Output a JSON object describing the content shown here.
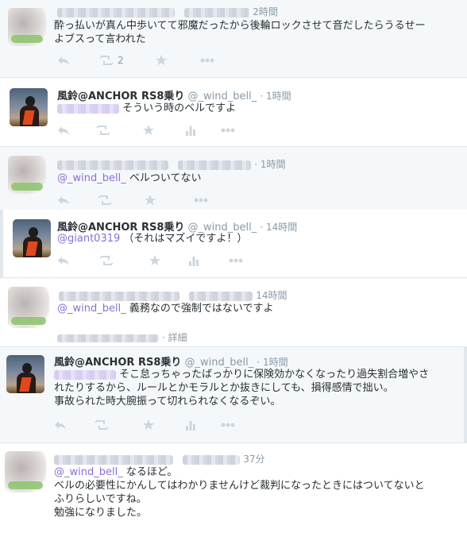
{
  "tweets": [
    {
      "time": "2時間",
      "text_lines": [
        "酔っ払いが真ん中歩いてて邪魔だったから後輪ロックさせて音だしたらうるせー",
        "よブスって言われた"
      ],
      "retweet_count": "2"
    },
    {
      "name": "風鈴@ANCHOR RS8乗り",
      "handle": "@_wind_bell_",
      "time": "· 1時間",
      "text_lines": [
        "そういう時のベルですよ"
      ]
    },
    {
      "time": "· 1時間",
      "mention": "@_wind_bell_",
      "text_lines": [
        "ベルついてない"
      ]
    },
    {
      "name": "風鈴@ANCHOR RS8乗り",
      "handle": "@_wind_bell_",
      "time": "· 14時間",
      "mention": "@giant0319",
      "text_lines": [
        "（それはマズイですよ！）"
      ]
    },
    {
      "time": "14時間",
      "mention": "@_wind_bell_",
      "text_lines": [
        "義務なので強制ではないですよ"
      ],
      "detail_label": "· 詳細"
    },
    {
      "name": "風鈴@ANCHOR RS8乗り",
      "handle": "@_wind_bell_",
      "time": "· 1時間",
      "text_lines": [
        "そこ怠っちゃったばっかりに保険効かなくなったり過失割合増やさ",
        "れたりするから、ルールとかモラルとか抜きにしても、損得感情で拙い。",
        "事故られた時大腕振って切れられなくなるぞい。"
      ]
    },
    {
      "time": "37分",
      "mention": "@_wind_bell_",
      "text_lines": [
        "なるほど。",
        "ベルの必要性にかんしてはわかりませんけど裁判になったときにはついてないと",
        "ふりらしいですね。",
        "勉強になりました。"
      ]
    }
  ],
  "icons": [
    "reply-icon",
    "retweet-icon",
    "favorite-icon",
    "analytics-icon",
    "more-icon"
  ]
}
